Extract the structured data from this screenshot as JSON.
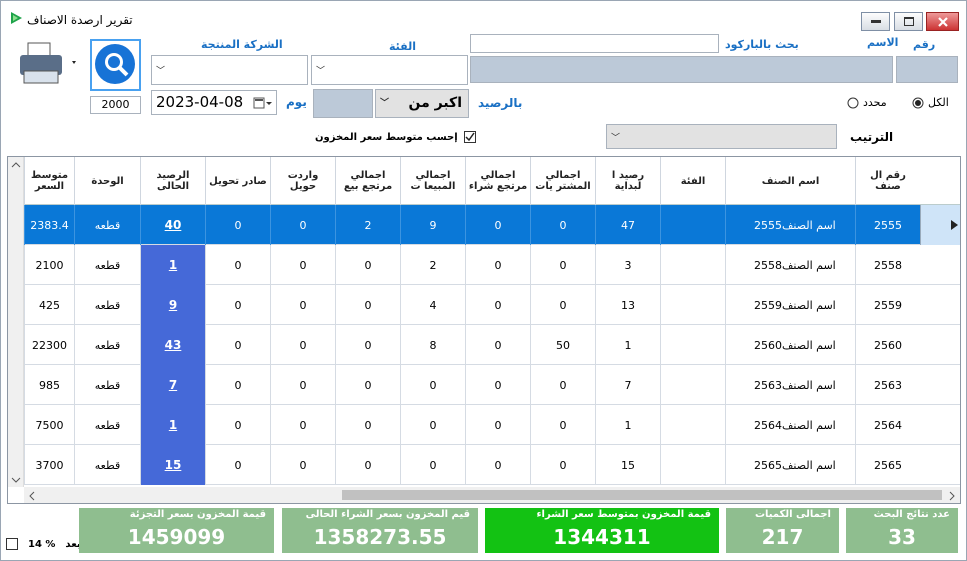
{
  "window": {
    "title": "تقرير ارصدة الاصناف"
  },
  "filters": {
    "number_label": "رقم",
    "name_label": "الاسم",
    "barcode_label": "بحث بالباركود",
    "category_label": "الفئة",
    "company_label": "الشركة المنتجة",
    "print_count": "2000",
    "date_value": "2023-04-08",
    "day_label": "يوم",
    "op_value": "اكبر من",
    "balance_label": "بالرصيد",
    "radio_specific": "محدد",
    "radio_all": "الكل",
    "avg_checkbox_label": "إحسب متوسط سعر المخزون",
    "sort_label": "الترتيب"
  },
  "columns": [
    "رقم ال صنف",
    "اسم الصنف",
    "الفئة",
    "رصيد ا لبداية",
    "اجمالي المشتر يات",
    "اجمالي مرتجع شراء",
    "اجمالي المبيعا ت",
    "اجمالي مرتجع بيع",
    "واردت حويل",
    "صادر تحويل",
    "الرصيد الحالى",
    "الوحدة",
    "متوسط السعر"
  ],
  "rows": [
    {
      "id": "2555",
      "name": "2555اسم الصنف",
      "cat": "",
      "start": "47",
      "purch": "0",
      "pret": "0",
      "sales": "9",
      "sret": "2",
      "tin": "0",
      "tout": "0",
      "bal": "40",
      "unit": "قطعه",
      "avg": "2383.4"
    },
    {
      "id": "2558",
      "name": "2558اسم الصنف",
      "cat": "",
      "start": "3",
      "purch": "0",
      "pret": "0",
      "sales": "2",
      "sret": "0",
      "tin": "0",
      "tout": "0",
      "bal": "1",
      "unit": "قطعه",
      "avg": "2100"
    },
    {
      "id": "2559",
      "name": "2559اسم الصنف",
      "cat": "",
      "start": "13",
      "purch": "0",
      "pret": "0",
      "sales": "4",
      "sret": "0",
      "tin": "0",
      "tout": "0",
      "bal": "9",
      "unit": "قطعه",
      "avg": "425"
    },
    {
      "id": "2560",
      "name": "2560اسم الصنف",
      "cat": "",
      "start": "1",
      "purch": "50",
      "pret": "0",
      "sales": "8",
      "sret": "0",
      "tin": "0",
      "tout": "0",
      "bal": "43",
      "unit": "قطعه",
      "avg": "22300"
    },
    {
      "id": "2563",
      "name": "2563اسم الصنف",
      "cat": "",
      "start": "7",
      "purch": "0",
      "pret": "0",
      "sales": "0",
      "sret": "0",
      "tin": "0",
      "tout": "0",
      "bal": "7",
      "unit": "قطعه",
      "avg": "985"
    },
    {
      "id": "2564",
      "name": "2564اسم الصنف",
      "cat": "",
      "start": "1",
      "purch": "0",
      "pret": "0",
      "sales": "0",
      "sret": "0",
      "tin": "0",
      "tout": "0",
      "bal": "1",
      "unit": "قطعه",
      "avg": "7500"
    },
    {
      "id": "2565",
      "name": "2565اسم الصنف",
      "cat": "",
      "start": "15",
      "purch": "0",
      "pret": "0",
      "sales": "0",
      "sret": "0",
      "tin": "0",
      "tout": "0",
      "bal": "15",
      "unit": "قطعه",
      "avg": "3700"
    }
  ],
  "summary": {
    "count_label": "عدد نتائج البحث",
    "count_value": "33",
    "qty_label": "اجمالى الكميات",
    "qty_value": "217",
    "avgval_label": "قيمة المخزون بمتوسط سعر الشراء",
    "avgval_value": "1344311",
    "curr_label": "قيم المخزون بسعر الشراء الحالى",
    "curr_value": "1358273.55",
    "retail_label": "قيمة المخزون بسعر التجزئة",
    "retail_value": "1459099",
    "after_label": "بعد",
    "after_pct": "14 %"
  }
}
